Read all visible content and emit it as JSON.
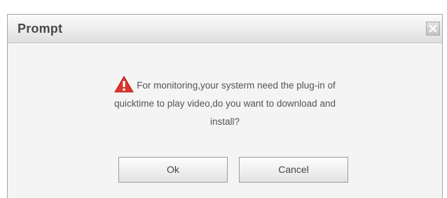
{
  "dialog": {
    "title": "Prompt",
    "close_icon": "close-icon",
    "warning_icon": "warning-icon",
    "message_line1": "For monitoring,your systerm need the plug-in of",
    "message_line2": "quicktime to play video,do you want to download and",
    "message_line3": "install?",
    "ok_label": "Ok",
    "cancel_label": "Cancel"
  },
  "colors": {
    "warning": "#d9362b",
    "titlebar": "#ececec",
    "dialog_background": "#f4f4f4",
    "text": "#555555"
  }
}
